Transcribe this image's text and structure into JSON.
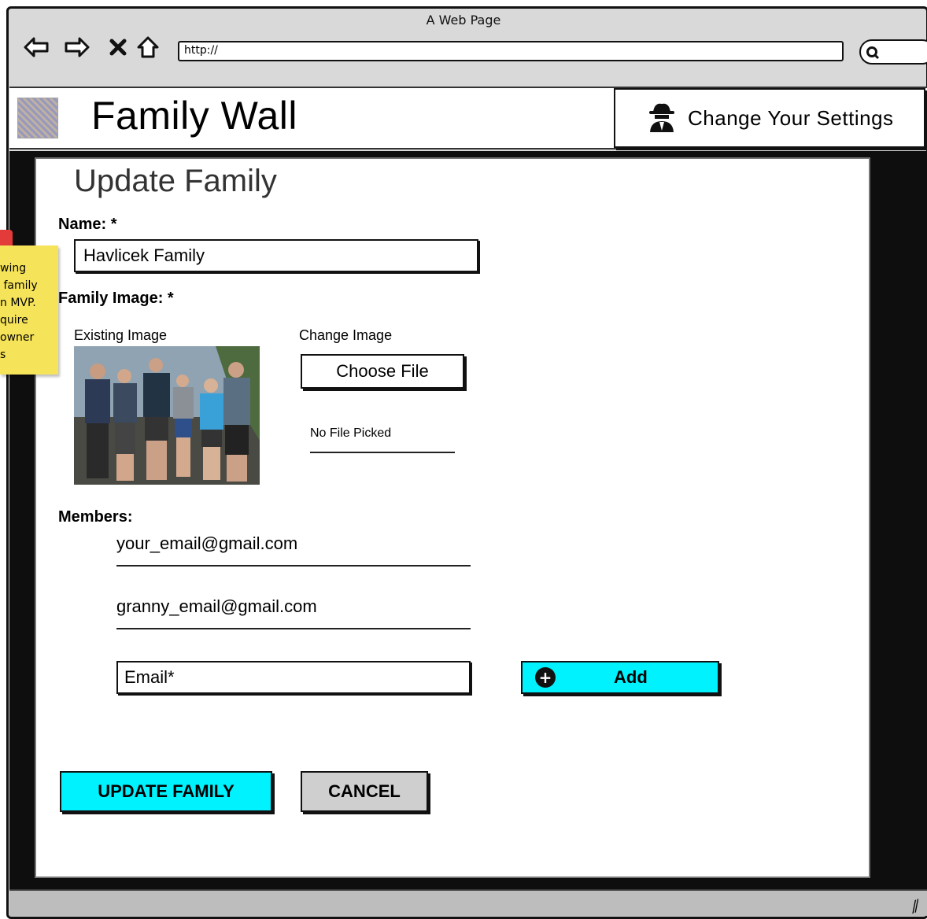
{
  "browser": {
    "title": "A Web Page",
    "url": "http://",
    "nav_icons": [
      "back-arrow-icon",
      "forward-arrow-icon",
      "stop-icon",
      "home-icon"
    ],
    "search_icon": "search-icon"
  },
  "header": {
    "app_title": "Family Wall",
    "settings_button_label": "Change Your Settings",
    "settings_icon": "spy-icon"
  },
  "sticky_note": {
    "text": "wing\n family\nn MVP.\nquire\nowner\ns"
  },
  "form": {
    "page_title": "Update Family",
    "name_label": "Name: *",
    "name_value": "Havlicek Family",
    "image_label": "Family Image: *",
    "existing_image_label": "Existing Image",
    "change_image_label": "Change Image",
    "choose_file_label": "Choose File",
    "no_file_text": "No File Picked",
    "members_label": "Members:",
    "members": [
      "your_email@gmail.com",
      "granny_email@gmail.com"
    ],
    "email_placeholder": "Email*",
    "add_button_label": "Add",
    "update_button_label": "UPDATE FAMILY",
    "cancel_button_label": "CANCEL"
  },
  "colors": {
    "accent": "#00f2ff",
    "cancel": "#cfcfcf",
    "sticky": "#f5e35a"
  }
}
